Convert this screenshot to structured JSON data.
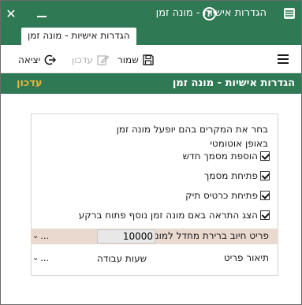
{
  "window": {
    "title": "הגדרות אישיות - מונה זמן",
    "help_label": "?",
    "close_label": "✕"
  },
  "tabs": [
    {
      "label": "הגדרות אישיות - מונה זמן",
      "active": true
    }
  ],
  "toolbar": {
    "save_label": "שמור",
    "edit_label": "עדכון",
    "exit_label": "יציאה"
  },
  "header": {
    "title": "הגדרות אישיות - מונה זמן",
    "update_label": "עדכון"
  },
  "form": {
    "description_line1": "בחר את המקרים בהם יופעל מונה זמן",
    "description_line2": "באופן אוטומטי",
    "checkboxes": [
      {
        "label": "הוספת מסמך חדש",
        "checked": true
      },
      {
        "label": "פתיחת מסמך",
        "checked": true
      },
      {
        "label": "פתיחת כרטיס תיק",
        "checked": true
      },
      {
        "label": "הצג התראה באם מונה זמן נוסף פתוח ברקע",
        "checked": true
      }
    ],
    "default_item": {
      "label": "פריט חיוב ברירת מחדל למונה זמן",
      "value": "10000",
      "lookup_label": "..."
    },
    "item_description": {
      "label": "תיאור פריט",
      "value": "שעות עבודה",
      "lookup_label": "..."
    }
  },
  "colors": {
    "accent": "#2f7a55",
    "update_link": "#e6b43c",
    "highlight_row": "#e9d9cf"
  }
}
